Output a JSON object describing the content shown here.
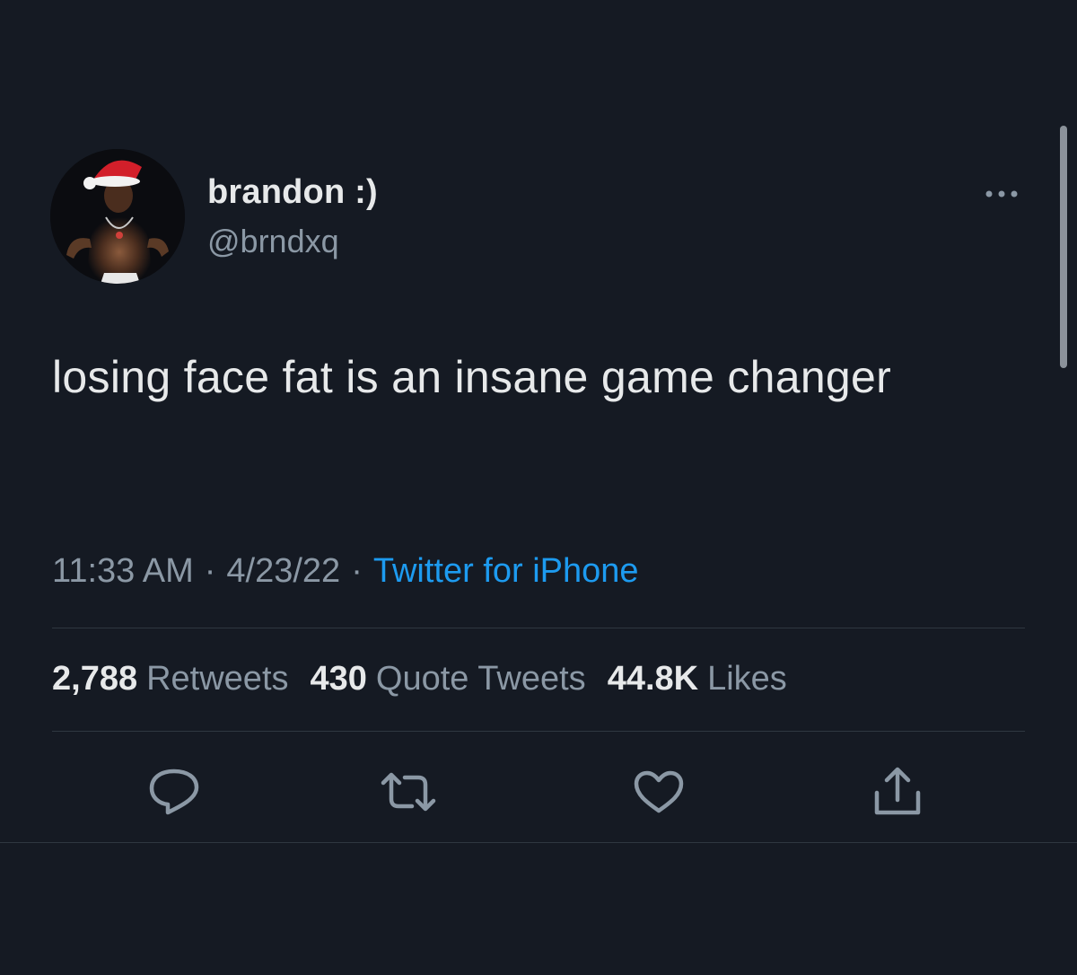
{
  "tweet": {
    "display_name": "brandon :)",
    "handle": "@brndxq",
    "text": "losing face fat is an insane game changer",
    "time": "11:33 AM",
    "date": "4/23/22",
    "source": "Twitter for iPhone",
    "separator": "·"
  },
  "stats": {
    "retweets_count": "2,788",
    "retweets_label": "Retweets",
    "quotes_count": "430",
    "quotes_label": "Quote Tweets",
    "likes_count": "44.8K",
    "likes_label": "Likes"
  },
  "icons": {
    "more": "more-horizontal-icon",
    "reply": "reply-icon",
    "retweet": "retweet-icon",
    "like": "heart-icon",
    "share": "share-icon"
  },
  "colors": {
    "background": "#151a23",
    "text_primary": "#e7e9ea",
    "text_secondary": "#8b98a5",
    "link": "#1d9bf0",
    "divider": "#2f3740"
  }
}
